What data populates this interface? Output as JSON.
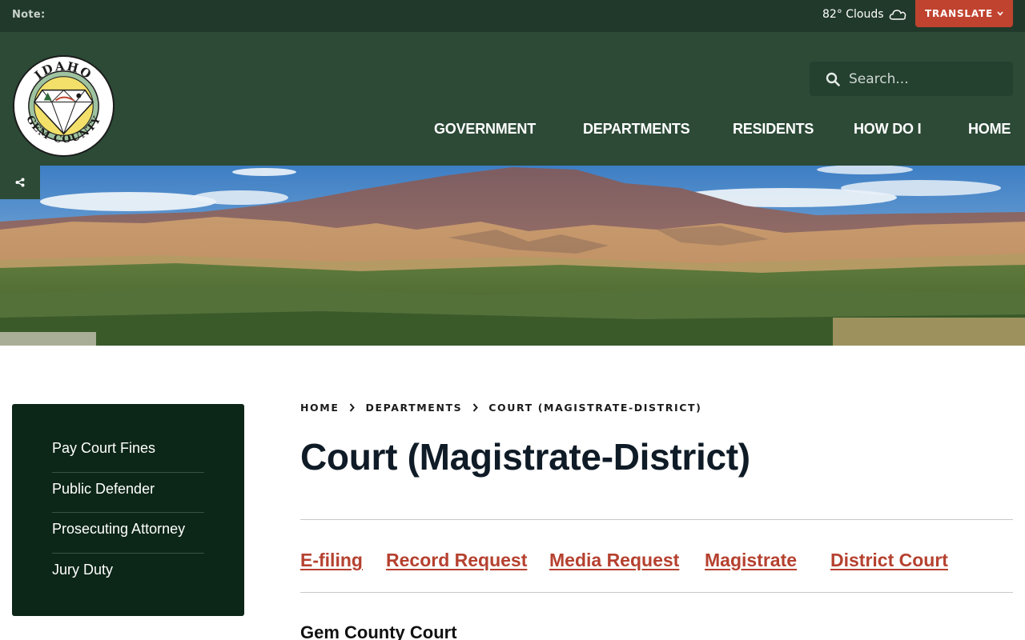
{
  "topbar": {
    "note_label": "Note:",
    "weather": "82° Clouds",
    "translate_label": "TRANSLATE"
  },
  "header": {
    "logo": {
      "top_text": "IDAHO",
      "bottom_text": "GEM COUNTY"
    },
    "search": {
      "placeholder": "Search..."
    },
    "nav": [
      {
        "label": "GOVERNMENT"
      },
      {
        "label": "DEPARTMENTS"
      },
      {
        "label": "RESIDENTS"
      },
      {
        "label": "HOW DO I"
      },
      {
        "label": "HOME"
      }
    ]
  },
  "sidebar": {
    "items": [
      {
        "label": "Pay Court Fines"
      },
      {
        "label": "Public Defender"
      },
      {
        "label": "Prosecuting Attorney"
      },
      {
        "label": "Jury Duty"
      }
    ]
  },
  "breadcrumb": [
    {
      "label": "HOME"
    },
    {
      "label": "DEPARTMENTS"
    },
    {
      "label": "COURT (MAGISTRATE-DISTRICT)"
    }
  ],
  "page": {
    "title": "Court (Magistrate-District)",
    "quick_links": [
      {
        "label": "E-filing"
      },
      {
        "label": "Record Request"
      },
      {
        "label": "Media Request"
      },
      {
        "label": "Magistrate"
      },
      {
        "label": "District Court"
      }
    ],
    "section_heading": "Gem County Court"
  },
  "colors": {
    "topbar_bg": "#21392b",
    "header_bg": "#2c4a36",
    "sidebar_bg": "#0c2617",
    "accent": "#c0432f",
    "link": "#b5412f"
  },
  "icons": {
    "weather": "cloud-icon",
    "translate": "chevron-down-icon",
    "search": "search-icon",
    "share": "share-icon",
    "breadcrumb_separator": "chevron-right-icon"
  }
}
